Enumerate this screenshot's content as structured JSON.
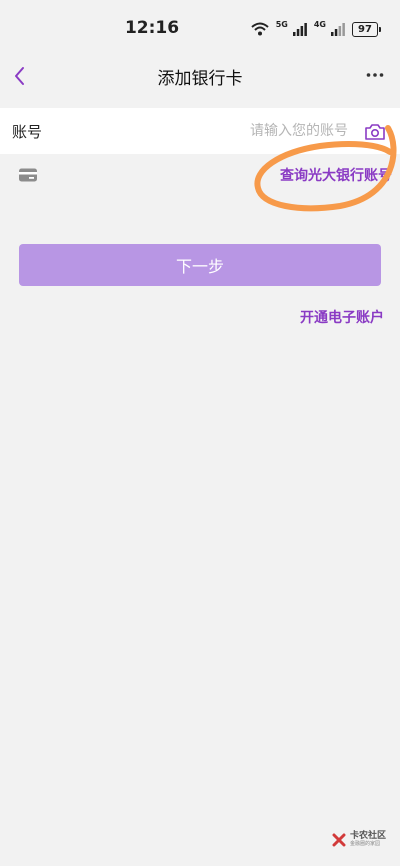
{
  "status_bar": {
    "time": "12:16",
    "signal1_label": "5G",
    "signal2_label": "4G",
    "battery": "97",
    "icons": [
      "wifi-icon",
      "signal-5g-icon",
      "signal-4g-icon",
      "battery-icon"
    ]
  },
  "nav": {
    "title": "添加银行卡",
    "back_icon": "chevron-left-icon",
    "more_icon": "more-dots-icon"
  },
  "form": {
    "account_label": "账号",
    "account_value": "",
    "account_placeholder": "请输入您的账号",
    "camera_icon": "camera-scan-icon",
    "card_icon": "bank-card-icon",
    "query_link": "查询光大银行账号"
  },
  "actions": {
    "next_button": "下一步",
    "open_account_link": "开通电子账户"
  },
  "watermark": {
    "title": "卡农社区",
    "subtitle": "金融圈的家园"
  },
  "colors": {
    "accent": "#8a3bc4",
    "button": "#b896e4",
    "background": "#f2f2f2",
    "annotation": "#f79a4a"
  }
}
